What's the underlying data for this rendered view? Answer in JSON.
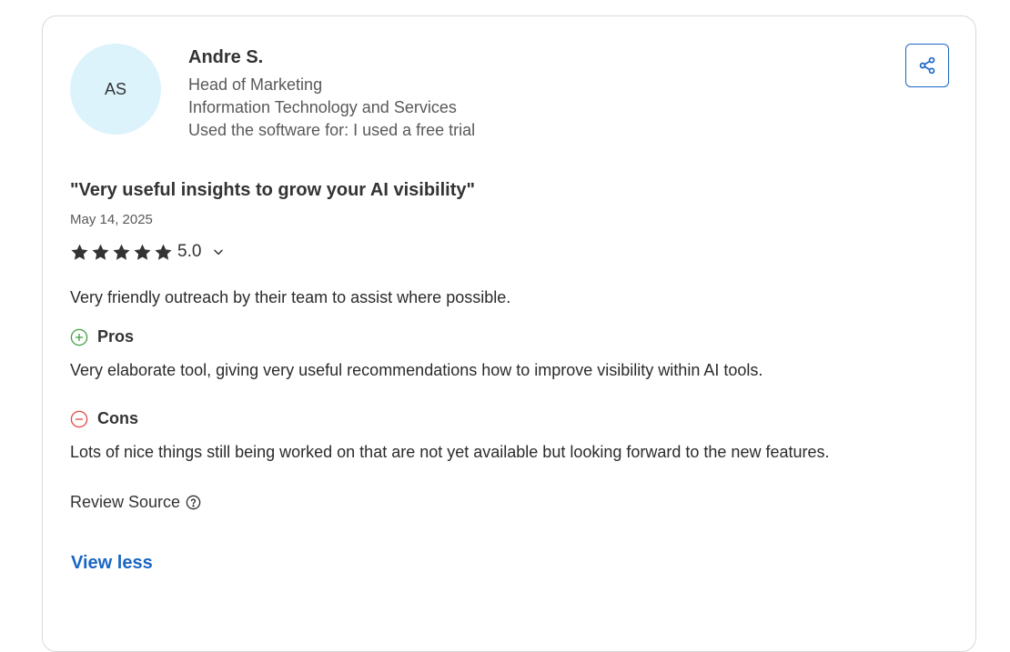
{
  "reviewer": {
    "initials": "AS",
    "name": "Andre S.",
    "job_title": "Head of Marketing",
    "industry": "Information Technology and Services",
    "usage": "Used the software for: I used a free trial"
  },
  "review": {
    "title": "\"Very useful insights to grow your AI visibility\"",
    "date": "May 14, 2025",
    "rating": "5.0",
    "stars": 5,
    "summary": "Very friendly outreach by their team to assist where possible.",
    "pros_label": "Pros",
    "pros_text": "Very elaborate tool, giving very useful recommendations how to improve visibility within AI tools.",
    "cons_label": "Cons",
    "cons_text": "Lots of nice things still being worked on that are not yet available but looking forward to the new features.",
    "source_label": "Review Source",
    "view_less_label": "View less"
  },
  "icons": {
    "share": "share-icon",
    "star": "star-icon",
    "chevron": "chevron-down-icon",
    "pros": "plus-circle-icon",
    "cons": "minus-circle-icon",
    "help": "question-circle-icon"
  },
  "colors": {
    "avatar_bg": "#dcf3fc",
    "accent": "#1a66c4",
    "pros": "#3fa142",
    "cons": "#e0463f",
    "star": "#333333"
  }
}
